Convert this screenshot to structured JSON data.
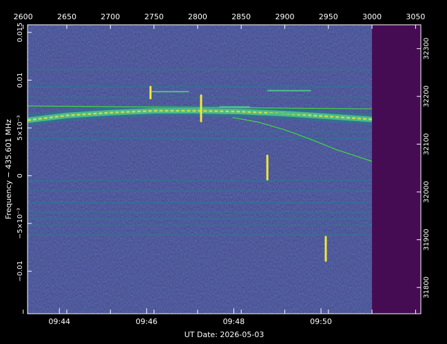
{
  "colors": {
    "background": "#000000",
    "plot_base": "#3b3f8c",
    "no_data": "#450c54",
    "frame": "#ffffff",
    "text": "#ffffff",
    "signal_bright": "#f4e636",
    "signal_mid": "#4cc389",
    "signal_low": "#2a7b8e",
    "overlay_line": "#3ddc3d"
  },
  "chart_data": {
    "type": "heatmap",
    "title": "",
    "xlabel": "UT Date: 2026-05-03",
    "ylabel": "Frequency − 435.601 MHz",
    "x2_ticks": [
      "2600",
      "2650",
      "2700",
      "2750",
      "2800",
      "2850",
      "2900",
      "2950",
      "3000",
      "3050"
    ],
    "x2_tick_values": [
      2600,
      2650,
      2700,
      2750,
      2800,
      2850,
      2900,
      2950,
      3000,
      3050
    ],
    "x2_range": [
      2605,
      3056
    ],
    "x_ticks": [
      "09:44",
      "09:46",
      "09:48",
      "09:50"
    ],
    "x_tick_values": [
      2641.5,
      2741.5,
      2841.5,
      2941.5
    ],
    "y_ticks": [
      {
        "value": 0.015,
        "label": "0.015"
      },
      {
        "value": 0.01,
        "label": "0.01"
      },
      {
        "value": 0.005,
        "label": "5×10⁻³"
      },
      {
        "value": 0,
        "label": "0"
      },
      {
        "value": -0.005,
        "label": "−5×10⁻³"
      },
      {
        "value": -0.01,
        "label": "−0.01"
      }
    ],
    "y_range": [
      -0.01445,
      0.0158
    ],
    "y2_ticks": [
      "32300",
      "32200",
      "32100",
      "32000",
      "31900",
      "31800"
    ],
    "y2_tick_values": [
      32300,
      32200,
      32100,
      32000,
      31900,
      31800
    ],
    "y2_range": [
      31745,
      32350
    ],
    "data_end_x2": 3000,
    "main_signal": {
      "x2": [
        2605,
        2650,
        2700,
        2750,
        2800,
        2850,
        2900,
        2950,
        3000
      ],
      "y": [
        0.0058,
        0.0063,
        0.0066,
        0.0068,
        0.0068,
        0.0067,
        0.0065,
        0.0062,
        0.0059
      ]
    },
    "faint_bands_y": [
      0.0111,
      0.0093,
      0.0082,
      0.0046,
      0.0039,
      -0.0005,
      -0.0016,
      -0.0028,
      -0.0038,
      -0.0045,
      -0.0052,
      -0.0062
    ],
    "overlay_lines": [
      {
        "x2": [
          2605,
          3000
        ],
        "y": [
          0.0073,
          0.007
        ]
      },
      {
        "x2": [
          2840,
          2870,
          2900,
          2930,
          2960,
          3000
        ],
        "y": [
          0.0061,
          0.0056,
          0.0048,
          0.0038,
          0.0027,
          0.0015
        ]
      }
    ],
    "bursts": [
      {
        "x2": 2746,
        "y_from": 0.0081,
        "y_to": 0.0093
      },
      {
        "x2": 2804,
        "y_from": 0.0057,
        "y_to": 0.0084
      },
      {
        "x2": 2880,
        "y_from": -0.0004,
        "y_to": 0.0021
      },
      {
        "x2": 2947,
        "y_from": -0.0089,
        "y_to": -0.0064
      }
    ],
    "short_segments": [
      {
        "x2": [
          2746,
          2790
        ],
        "y": 0.0088
      },
      {
        "x2": [
          2825,
          2860
        ],
        "y": 0.0072
      },
      {
        "x2": [
          2880,
          2930
        ],
        "y": 0.0089
      },
      {
        "x2": [
          2880,
          2930
        ],
        "y": 0.0065
      }
    ],
    "grid": false
  }
}
